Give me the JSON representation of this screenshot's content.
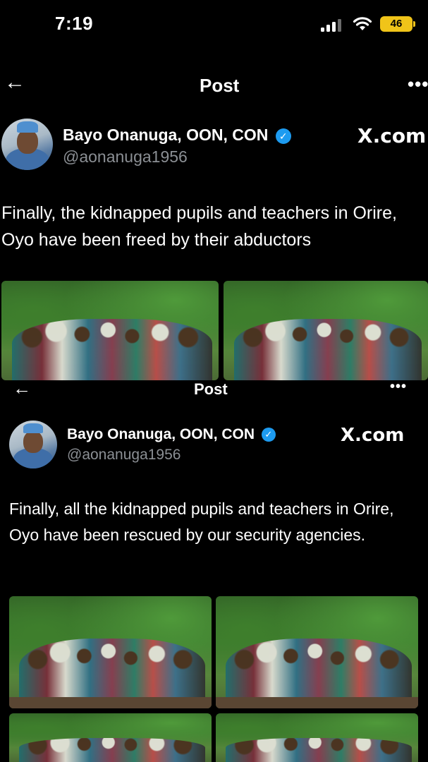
{
  "status_bar": {
    "time": "7:19",
    "battery": "46"
  },
  "post_top": {
    "header_title": "Post",
    "author_name": "Bayo Onanuga, OON, CON",
    "handle": "@aonanuga1956",
    "source_label": "X.com",
    "text": "Finally, the kidnapped pupils and teachers in Orire, Oyo have been freed by their abductors",
    "images": [
      {
        "description": "group-photo"
      },
      {
        "description": "group-photo"
      }
    ]
  },
  "post_bottom": {
    "header_title": "Post",
    "author_name": "Bayo Onanuga, OON, CON",
    "handle": "@aonanuga1956",
    "source_label": "X.com",
    "text": "Finally, all the kidnapped pupils and teachers in Orire, Oyo have been rescued by our security agencies.",
    "images": [
      {
        "description": "group-photo"
      },
      {
        "description": "group-photo"
      },
      {
        "description": "group-photo"
      },
      {
        "description": "group-photo"
      }
    ]
  },
  "icons": {
    "back": "arrow-left-icon",
    "more": "more-horizontal-icon",
    "verified": "verified-badge-icon",
    "signal": "cellular-signal-icon",
    "wifi": "wifi-icon",
    "battery": "battery-icon"
  },
  "colors": {
    "background": "#000000",
    "verified_blue": "#1d9bf0",
    "handle_gray": "#8b8f94",
    "battery_yellow": "#f0c419"
  }
}
